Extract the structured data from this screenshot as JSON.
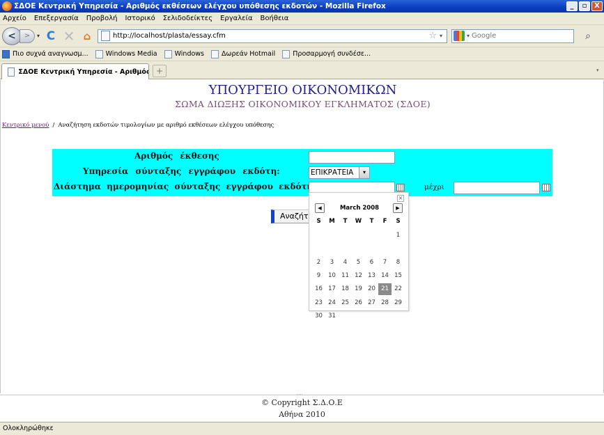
{
  "window": {
    "title": "ΣΔΟΕ  Κεντρική  Υπηρεσία - Αριθμός  εκθέσεων  ελέγχου  υπόθεσης  εκδοτών - Mozilla Firefox",
    "min_label": "_",
    "max_label": "▫",
    "close_label": "X"
  },
  "menu": [
    "Αρχείο",
    "Επεξεργασία",
    "Προβολή",
    "Ιστορικό",
    "Σελιδοδείκτες",
    "Εργαλεία",
    "Βοήθεια"
  ],
  "nav": {
    "url": "http://localhost/plasta/essay.cfm",
    "search_placeholder": "Google",
    "back_glyph": "<",
    "forward_glyph": ">",
    "reload_glyph": "C",
    "stop_glyph": "✕",
    "home_glyph": "⌂",
    "star_glyph": "☆",
    "search_glyph": "⌕",
    "dropdown_glyph": "▾"
  },
  "bookmarks": [
    "Πιο συχνά αναγνωσμ...",
    "Windows Media",
    "Windows",
    "Δωρεάν Hotmail",
    "Προσαρμογή συνδέσε..."
  ],
  "tab": {
    "label": "ΣΔΟΕ  Κεντρική  Υπηρεσία - Αριθμός...",
    "new_tab_glyph": "+",
    "list_glyph": "▾"
  },
  "page": {
    "ministry": "ΥΠΟΥΡΓΕΙΟ ΟΙΚΟΝΟΜΙΚΩΝ",
    "department": "ΣΩΜΑ ΔΙΩΞΗΣ ΟΙΚΟΝΟΜΙΚΟΥ ΕΓΚΛΗΜΑΤΟΣ (ΣΔΟΕ)",
    "breadcrumb_link": "Κεντρικό μενού",
    "breadcrumb_sep": "/",
    "breadcrumb_current": "Αναζήτηση εκδοτών τιμολογίων με αριθμό εκθέσεων ελέγχου υπόθεσης",
    "form": {
      "report_number_label": "Αριθμός  έκθεσης",
      "report_number_value": "",
      "service_label": "Υπηρεσία  σύνταξης  εγγράφου  εκδότη:",
      "service_value": "ΕΠΙΚΡΑΤΕΙΑ",
      "date_range_label": "Διάστημα ημερομηνίας  σύνταξης  εγγράφου  εκδότη:",
      "date_from_value": "",
      "until_label": "μέχρι",
      "date_to_value": "",
      "search_button": "Αναζήτηση"
    },
    "calendar": {
      "month_title": "March 2008",
      "prev_glyph": "◀",
      "next_glyph": "▶",
      "close_glyph": "×",
      "weekdays": [
        "S",
        "M",
        "T",
        "W",
        "T",
        "F",
        "S"
      ],
      "weeks": [
        [
          "",
          "",
          "",
          "",
          "",
          "",
          "1"
        ],
        [
          "",
          "",
          "",
          "",
          "",
          "",
          ""
        ],
        [
          "2",
          "3",
          "4",
          "5",
          "6",
          "7",
          "8"
        ],
        [
          "9",
          "10",
          "11",
          "12",
          "13",
          "14",
          "15"
        ],
        [
          "16",
          "17",
          "18",
          "19",
          "20",
          "21",
          "22"
        ],
        [
          "23",
          "24",
          "25",
          "26",
          "27",
          "28",
          "29"
        ],
        [
          "30",
          "31",
          "",
          "",
          "",
          "",
          ""
        ]
      ],
      "selected_day": "21"
    },
    "footer": {
      "copyright": "© Copyright Σ.Δ.Ο.Ε",
      "location": "Αθήνα 2010"
    }
  },
  "status": "Ολοκληρώθηκε"
}
